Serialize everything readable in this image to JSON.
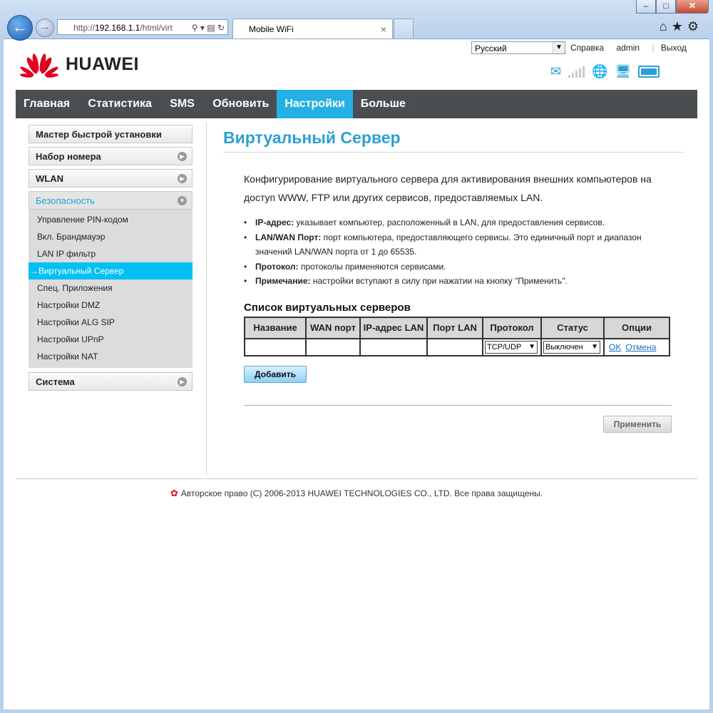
{
  "browser": {
    "address_prefix": "http://",
    "address_host": "192.168.1.1",
    "address_rest": "/html/virt",
    "tab_title": "Mobile WiFi",
    "tab_close": "×",
    "window_buttons": [
      "–",
      "□",
      "✕"
    ]
  },
  "header": {
    "brand": "HUAWEI",
    "language": "Русский",
    "help": "Справка",
    "user": "admin",
    "logout": "Выход"
  },
  "nav": [
    "Главная",
    "Статистика",
    "SMS",
    "Обновить",
    "Настройки",
    "Больше"
  ],
  "sidebar": {
    "quick_setup": "Мастер быстрой установки",
    "dialup": "Набор номера",
    "wlan": "WLAN",
    "security": "Безопасность",
    "security_items": [
      "Управление PIN-кодом",
      "Вкл. Брандмауэр",
      "LAN IP фильтр",
      "Виртуальный Сервер",
      "Спец. Приложения",
      "Настройки DMZ",
      "Настройки ALG SIP",
      "Настройки UPnP",
      "Настройки NAT"
    ],
    "active_prefix": "→",
    "system": "Система"
  },
  "content": {
    "title": "Виртуальный Сервер",
    "description": "Конфигурирование виртуального сервера для активирования внешних компьютеров на доступ WWW, FTP или других сервисов, предоставляемых LAN.",
    "bullets": [
      {
        "term": "IP-адрес:",
        "text": " указывает компьютер, расположенный в LAN, для предоставления сервисов."
      },
      {
        "term": "LAN/WAN Порт:",
        "text": " порт компьютера, предоставляющего сервисы. Это единичный порт и диапазон значений LAN/WAN порта от 1 до 65535."
      },
      {
        "term": "Протокол:",
        "text": " протоколы применяются сервисами."
      },
      {
        "term": "Примечание:",
        "text": " настройки вступают в силу при нажатии на кнопку \"Применить\"."
      }
    ],
    "list_title": "Список виртуальных серверов",
    "table_headers": [
      "Название",
      "WAN порт",
      "IP-адрес LAN",
      "Порт LAN",
      "Протокол",
      "Статус",
      "Опции"
    ],
    "row": {
      "protocol": "TCP/UDP",
      "status": "Выключен",
      "ok": "OK",
      "cancel": "Отмена"
    },
    "add_button": "Добавить",
    "apply_button": "Применить"
  },
  "footer": {
    "copyright": "Авторское право (C) 2006-2013 HUAWEI TECHNOLOGIES CO., LTD. Все права защищены."
  },
  "colors": {
    "accent": "#25b0e5",
    "nav_bg": "#4b4e50",
    "title": "#2fa0d3",
    "brand_red": "#e1001e"
  }
}
